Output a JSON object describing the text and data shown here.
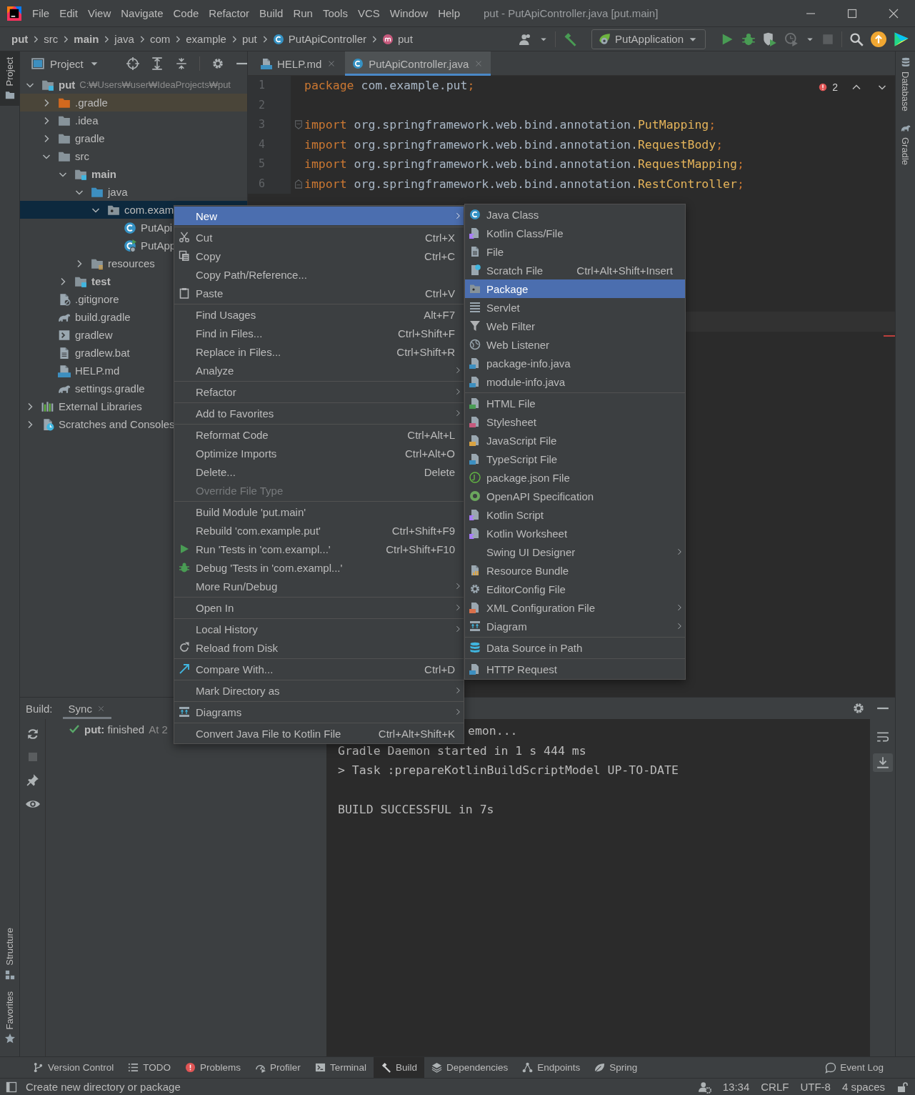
{
  "title_bar": {
    "menus": [
      "File",
      "Edit",
      "View",
      "Navigate",
      "Code",
      "Refactor",
      "Build",
      "Run",
      "Tools",
      "VCS",
      "Window",
      "Help"
    ],
    "title": "put - PutApiController.java [put.main]"
  },
  "nav_bar": {
    "breadcrumbs": [
      {
        "text": "put",
        "kind": "module"
      },
      {
        "text": "src",
        "kind": "folder"
      },
      {
        "text": "main",
        "kind": "module"
      },
      {
        "text": "java",
        "kind": "folder"
      },
      {
        "text": "com",
        "kind": "folder"
      },
      {
        "text": "example",
        "kind": "folder"
      },
      {
        "text": "put",
        "kind": "folder"
      },
      {
        "text": "PutApiController",
        "kind": "class"
      },
      {
        "text": "put",
        "kind": "method"
      }
    ],
    "run_config": "PutApplication"
  },
  "left_strip": {
    "top": [
      {
        "label": "Project",
        "selected": true
      }
    ],
    "bottom": [
      {
        "label": "Structure",
        "selected": false
      },
      {
        "label": "Favorites",
        "selected": false
      }
    ]
  },
  "right_strip": {
    "top": [
      {
        "label": "Database",
        "selected": false
      },
      {
        "label": "Gradle",
        "selected": false
      }
    ]
  },
  "project_panel": {
    "title": "Project",
    "tree": [
      {
        "name": "put",
        "path": "C:₩Users₩user₩IdeaProjects₩put",
        "kind": "module",
        "expanded": true,
        "selected": false,
        "children": [
          {
            "name": ".gradle",
            "kind": "excluded",
            "expanded": false,
            "selected": false
          },
          {
            "name": ".idea",
            "kind": "folder",
            "expanded": false,
            "selected": false
          },
          {
            "name": "gradle",
            "kind": "folder",
            "expanded": false,
            "selected": false
          },
          {
            "name": "src",
            "kind": "folder",
            "expanded": true,
            "selected": false,
            "children": [
              {
                "name": "main",
                "kind": "module",
                "expanded": true,
                "selected": false,
                "children": [
                  {
                    "name": "java",
                    "kind": "source",
                    "expanded": true,
                    "selected": false,
                    "children": [
                      {
                        "name": "com.exam",
                        "kind": "package",
                        "expanded": true,
                        "selected": true,
                        "children": [
                          {
                            "name": "PutApi",
                            "kind": "class",
                            "selected": false
                          },
                          {
                            "name": "PutApp",
                            "kind": "app",
                            "selected": false
                          }
                        ]
                      }
                    ]
                  },
                  {
                    "name": "resources",
                    "kind": "resources",
                    "expanded": false,
                    "selected": false
                  }
                ]
              },
              {
                "name": "test",
                "kind": "module",
                "expanded": false,
                "selected": false
              }
            ]
          },
          {
            "name": ".gitignore",
            "kind": "ignore",
            "selected": false
          },
          {
            "name": "build.gradle",
            "kind": "gradle",
            "selected": false
          },
          {
            "name": "gradlew",
            "kind": "script",
            "selected": false
          },
          {
            "name": "gradlew.bat",
            "kind": "bat",
            "selected": false
          },
          {
            "name": "HELP.md",
            "kind": "md",
            "selected": false
          },
          {
            "name": "settings.gradle",
            "kind": "gradle",
            "selected": false
          }
        ]
      },
      {
        "name": "External Libraries",
        "kind": "libs",
        "expanded": false,
        "selected": false
      },
      {
        "name": "Scratches and Consoles",
        "kind": "scratches",
        "expanded": false,
        "selected": false
      }
    ]
  },
  "editor": {
    "tabs": [
      {
        "label": "HELP.md",
        "selected": false
      },
      {
        "label": "PutApiController.java",
        "selected": true
      }
    ],
    "error_count": "2",
    "lines": [
      {
        "number": "1",
        "kind": "code",
        "segments": [
          {
            "text": "package",
            "kind": "keyword"
          },
          {
            "text": " com.example.put",
            "kind": "plain"
          },
          {
            "text": ";",
            "kind": "keyword"
          }
        ]
      },
      {
        "number": "2",
        "kind": "code"
      },
      {
        "number": "3",
        "kind": "fold_start",
        "segments": [
          {
            "text": "import",
            "kind": "keyword"
          },
          {
            "text": " org.springframework.web.bind.annotation.",
            "kind": "plain"
          },
          {
            "text": "PutMapping",
            "kind": "annotation"
          },
          {
            "text": ";",
            "kind": "keyword"
          }
        ]
      },
      {
        "number": "4",
        "kind": "code",
        "segments": [
          {
            "text": "import",
            "kind": "keyword"
          },
          {
            "text": " org.springframework.web.bind.annotation.",
            "kind": "plain"
          },
          {
            "text": "RequestBody",
            "kind": "annotation"
          },
          {
            "text": ";",
            "kind": "keyword"
          }
        ]
      },
      {
        "number": "5",
        "kind": "code",
        "segments": [
          {
            "text": "import",
            "kind": "keyword"
          },
          {
            "text": " org.springframework.web.bind.annotation.",
            "kind": "plain"
          },
          {
            "text": "RequestMapping",
            "kind": "annotation"
          },
          {
            "text": ";",
            "kind": "keyword"
          }
        ]
      },
      {
        "number": "6",
        "kind": "fold_end",
        "segments": [
          {
            "text": "import",
            "kind": "keyword"
          },
          {
            "text": " org.springframework.web.bind.annotation.",
            "kind": "plain"
          },
          {
            "text": "RestController",
            "kind": "annotation"
          },
          {
            "text": ";",
            "kind": "keyword"
          }
        ]
      }
    ]
  },
  "context_menu": {
    "groups": [
      [
        {
          "label": "New",
          "submenu": true,
          "disabled": false,
          "selected": true
        }
      ],
      [
        {
          "label": "Cut",
          "shortcut": "Ctrl+X",
          "submenu": false,
          "disabled": false,
          "selected": false
        },
        {
          "label": "Copy",
          "shortcut": "Ctrl+C",
          "submenu": false,
          "disabled": false,
          "selected": false
        },
        {
          "label": "Copy Path/Reference...",
          "submenu": false,
          "disabled": false,
          "selected": false
        },
        {
          "label": "Paste",
          "shortcut": "Ctrl+V",
          "submenu": false,
          "disabled": false,
          "selected": false
        }
      ],
      [
        {
          "label": "Find Usages",
          "shortcut": "Alt+F7",
          "submenu": false,
          "disabled": false,
          "selected": false
        },
        {
          "label": "Find in Files...",
          "shortcut": "Ctrl+Shift+F",
          "submenu": false,
          "disabled": false,
          "selected": false
        },
        {
          "label": "Replace in Files...",
          "shortcut": "Ctrl+Shift+R",
          "submenu": false,
          "disabled": false,
          "selected": false
        },
        {
          "label": "Analyze",
          "submenu": true,
          "disabled": false,
          "selected": false
        }
      ],
      [
        {
          "label": "Refactor",
          "submenu": true,
          "disabled": false,
          "selected": false
        }
      ],
      [
        {
          "label": "Add to Favorites",
          "submenu": true,
          "disabled": false,
          "selected": false
        }
      ],
      [
        {
          "label": "Reformat Code",
          "shortcut": "Ctrl+Alt+L",
          "submenu": false,
          "disabled": false,
          "selected": false
        },
        {
          "label": "Optimize Imports",
          "shortcut": "Ctrl+Alt+O",
          "submenu": false,
          "disabled": false,
          "selected": false
        },
        {
          "label": "Delete...",
          "shortcut": "Delete",
          "submenu": false,
          "disabled": false,
          "selected": false
        },
        {
          "label": "Override File Type",
          "submenu": false,
          "disabled": true,
          "selected": false
        }
      ],
      [
        {
          "label": "Build Module 'put.main'",
          "submenu": false,
          "disabled": false,
          "selected": false
        },
        {
          "label": "Rebuild 'com.example.put'",
          "shortcut": "Ctrl+Shift+F9",
          "submenu": false,
          "disabled": false,
          "selected": false
        },
        {
          "label": "Run 'Tests in 'com.exampl...'",
          "shortcut": "Ctrl+Shift+F10",
          "submenu": false,
          "disabled": false,
          "selected": false
        },
        {
          "label": "Debug 'Tests in 'com.exampl...'",
          "submenu": false,
          "disabled": false,
          "selected": false
        },
        {
          "label": "More Run/Debug",
          "submenu": true,
          "disabled": false,
          "selected": false
        }
      ],
      [
        {
          "label": "Open In",
          "submenu": true,
          "disabled": false,
          "selected": false
        }
      ],
      [
        {
          "label": "Local History",
          "submenu": true,
          "disabled": false,
          "selected": false
        },
        {
          "label": "Reload from Disk",
          "submenu": false,
          "disabled": false,
          "selected": false
        }
      ],
      [
        {
          "label": "Compare With...",
          "shortcut": "Ctrl+D",
          "submenu": false,
          "disabled": false,
          "selected": false
        }
      ],
      [
        {
          "label": "Mark Directory as",
          "submenu": true,
          "disabled": false,
          "selected": false
        }
      ],
      [
        {
          "label": "Diagrams",
          "submenu": true,
          "disabled": false,
          "selected": false
        }
      ],
      [
        {
          "label": "Convert Java File to Kotlin File",
          "shortcut": "Ctrl+Alt+Shift+K",
          "submenu": false,
          "disabled": false,
          "selected": false
        }
      ]
    ]
  },
  "new_submenu": {
    "groups": [
      [
        {
          "label": "Java Class",
          "submenu": false,
          "selected": false
        },
        {
          "label": "Kotlin Class/File",
          "submenu": false,
          "selected": false
        },
        {
          "label": "File",
          "submenu": false,
          "selected": false
        },
        {
          "label": "Scratch File",
          "shortcut": "Ctrl+Alt+Shift+Insert",
          "submenu": false,
          "selected": false
        },
        {
          "label": "Package",
          "submenu": false,
          "selected": true
        },
        {
          "label": "Servlet",
          "submenu": false,
          "selected": false
        },
        {
          "label": "Web Filter",
          "submenu": false,
          "selected": false
        },
        {
          "label": "Web Listener",
          "submenu": false,
          "selected": false
        },
        {
          "label": "package-info.java",
          "submenu": false,
          "selected": false
        },
        {
          "label": "module-info.java",
          "submenu": false,
          "selected": false
        }
      ],
      [
        {
          "label": "HTML File",
          "submenu": false,
          "selected": false
        },
        {
          "label": "Stylesheet",
          "submenu": false,
          "selected": false
        },
        {
          "label": "JavaScript File",
          "submenu": false,
          "selected": false
        },
        {
          "label": "TypeScript File",
          "submenu": false,
          "selected": false
        },
        {
          "label": "package.json File",
          "submenu": false,
          "selected": false
        },
        {
          "label": "OpenAPI Specification",
          "submenu": false,
          "selected": false
        },
        {
          "label": "Kotlin Script",
          "submenu": false,
          "selected": false
        },
        {
          "label": "Kotlin Worksheet",
          "submenu": false,
          "selected": false
        },
        {
          "label": "Swing UI Designer",
          "submenu": true,
          "selected": false
        },
        {
          "label": "Resource Bundle",
          "submenu": false,
          "selected": false
        },
        {
          "label": "EditorConfig File",
          "submenu": false,
          "selected": false
        },
        {
          "label": "XML Configuration File",
          "submenu": true,
          "selected": false
        },
        {
          "label": "Diagram",
          "submenu": true,
          "selected": false
        }
      ],
      [
        {
          "label": "Data Source in Path",
          "submenu": false,
          "selected": false
        }
      ],
      [
        {
          "label": "HTTP Request",
          "submenu": false,
          "selected": false
        }
      ]
    ]
  },
  "build_panel": {
    "label": "Build:",
    "tabs": [
      {
        "label": "Sync",
        "selected": true
      }
    ],
    "result": {
      "text": "**put:** finished",
      "time": "At 2"
    },
    "console": [
      [
        "emon...",
        "Gradle Daemon started in 1 s 444 ms",
        "> Task :prepareKotlinBuildScriptModel UP-TO-DATE"
      ],
      [
        "BUILD SUCCESSFUL in 7s"
      ]
    ],
    "console_toggles": [
      {
        "selected": false
      },
      {
        "selected": true
      }
    ]
  },
  "tool_windows": [
    {
      "label": "Version Control",
      "selected": false
    },
    {
      "label": "TODO",
      "selected": false
    },
    {
      "label": "Problems",
      "selected": false
    },
    {
      "label": "Profiler",
      "selected": false
    },
    {
      "label": "Terminal",
      "selected": false
    },
    {
      "label": "Build",
      "selected": true
    },
    {
      "label": "Dependencies",
      "selected": false
    },
    {
      "label": "Endpoints",
      "selected": false
    },
    {
      "label": "Spring",
      "selected": false
    }
  ],
  "event_log": "Event Log",
  "status_bar": {
    "message": "Create new directory or package",
    "items": [
      "13:34",
      "CRLF",
      "UTF-8",
      "4 spaces"
    ]
  }
}
